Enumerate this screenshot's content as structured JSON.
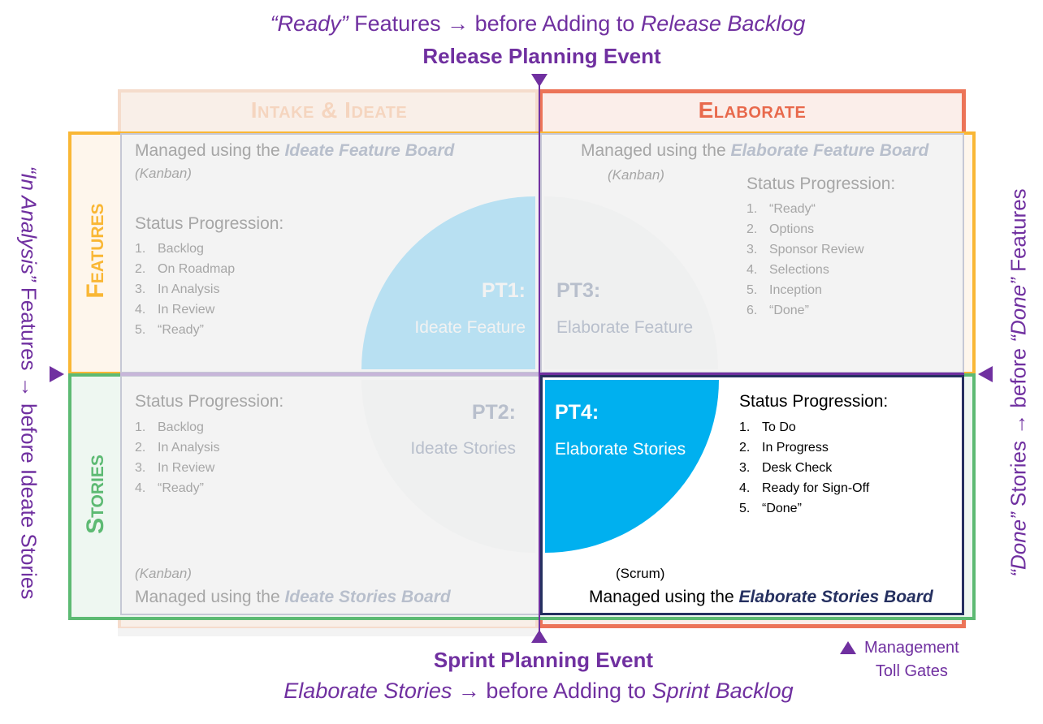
{
  "header": {
    "line1": {
      "italic_lead": "“Ready”",
      "text": " Features → before Adding to ",
      "italic_tail": "Release Backlog"
    },
    "event": "Release Planning Event"
  },
  "footer": {
    "event": "Sprint Planning Event",
    "line2": {
      "italic_lead": "Elaborate Stories",
      "text": " → before Adding to ",
      "italic_tail": "Sprint Backlog"
    }
  },
  "columns": {
    "intake": "Intake & Ideate",
    "elaborate": "Elaborate"
  },
  "rows": {
    "features": "Features",
    "stories": "Stories"
  },
  "side_left": {
    "italic_lead": "“In Analysis”",
    "text": " Features → before Ideate Stories"
  },
  "side_right": {
    "italic_lead": "“Done”",
    "text": " Stories → before ",
    "italic_mid": "“Done”",
    "tail": " Features"
  },
  "quadrants": {
    "pt1": {
      "code": "PT1:",
      "name": "Ideate Feature",
      "managed_prefix": "Managed using the ",
      "board": "Ideate Feature Board",
      "method": "(Kanban)",
      "status_heading": "Status Progression:",
      "statuses": [
        "Backlog",
        "On Roadmap",
        "In Analysis",
        "In Review",
        "“Ready”"
      ]
    },
    "pt3": {
      "code": "PT3:",
      "name": "Elaborate Feature",
      "managed_prefix": "Managed using the ",
      "board": "Elaborate Feature Board",
      "method": "(Kanban)",
      "status_heading": "Status Progression:",
      "statuses": [
        "“Ready“",
        "Options",
        "Sponsor Review",
        "Selections",
        "Inception",
        "“Done”"
      ]
    },
    "pt2": {
      "code": "PT2:",
      "name": "Ideate Stories",
      "managed_prefix": "Managed using the ",
      "board": "Ideate Stories Board",
      "method": "(Kanban)",
      "status_heading": "Status Progression:",
      "statuses": [
        "Backlog",
        "In Analysis",
        "In Review",
        "“Ready”"
      ]
    },
    "pt4": {
      "code": "PT4:",
      "name": "Elaborate Stories",
      "managed_prefix": "Managed using the ",
      "board": "Elaborate Stories Board",
      "method": "(Scrum)",
      "status_heading": "Status Progression:",
      "statuses": [
        "To Do",
        "In Progress",
        "Desk Check",
        "Ready for Sign-Off",
        "“Done”"
      ]
    }
  },
  "legend": {
    "line1": "Management",
    "line2": "Toll Gates",
    "icon": "triangle-up-icon"
  },
  "colors": {
    "purple": "#7030a0",
    "intake": "#f5d5bf",
    "elaborate": "#ec7458",
    "features": "#f9b735",
    "stories": "#5dba73",
    "pt1": "#b8e0f2",
    "pt4": "#00b0ef",
    "board_dark": "#253060"
  }
}
